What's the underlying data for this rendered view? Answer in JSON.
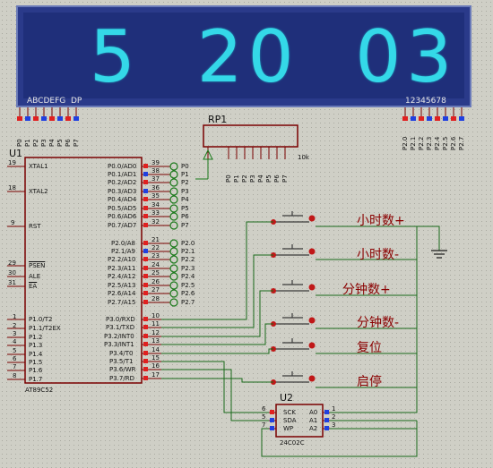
{
  "display": {
    "digits": "5  20  03",
    "left_label": "ABCDEFG  DP",
    "right_label": "12345678",
    "seg_color": "#34d8e8",
    "bg_color": "#1f2f7a"
  },
  "left_pins": [
    "P0",
    "P1",
    "P2",
    "P3",
    "P4",
    "P5",
    "P6",
    "P7"
  ],
  "right_pins": [
    "P2.0",
    "P2.1",
    "P2.2",
    "P2.3",
    "P2.4",
    "P2.5",
    "P2.6",
    "P2.7"
  ],
  "rp1": {
    "name": "RP1",
    "value": "10k",
    "pins": [
      "P0",
      "P1",
      "P2",
      "P3",
      "P4",
      "P5",
      "P6",
      "P7"
    ]
  },
  "u1": {
    "ref": "U1",
    "part": "AT89C52",
    "left_pins": [
      {
        "num": "19",
        "name": "XTAL1"
      },
      {
        "num": "18",
        "name": "XTAL2"
      },
      {
        "num": "9",
        "name": "RST"
      },
      {
        "num": "29",
        "name": "PSEN"
      },
      {
        "num": "30",
        "name": "ALE"
      },
      {
        "num": "31",
        "name": "EA"
      },
      {
        "num": "1",
        "name": "P1.0/T2"
      },
      {
        "num": "2",
        "name": "P1.1/T2EX"
      },
      {
        "num": "3",
        "name": "P1.2"
      },
      {
        "num": "4",
        "name": "P1.3"
      },
      {
        "num": "5",
        "name": "P1.4"
      },
      {
        "num": "6",
        "name": "P1.5"
      },
      {
        "num": "7",
        "name": "P1.6"
      },
      {
        "num": "8",
        "name": "P1.7"
      }
    ],
    "right_pins_p0": [
      {
        "num": "39",
        "name": "P0.0/AD0",
        "net": "P0"
      },
      {
        "num": "38",
        "name": "P0.1/AD1",
        "net": "P1"
      },
      {
        "num": "37",
        "name": "P0.2/AD2",
        "net": "P2"
      },
      {
        "num": "36",
        "name": "P0.3/AD3",
        "net": "P3"
      },
      {
        "num": "35",
        "name": "P0.4/AD4",
        "net": "P4"
      },
      {
        "num": "34",
        "name": "P0.5/AD5",
        "net": "P5"
      },
      {
        "num": "33",
        "name": "P0.6/AD6",
        "net": "P6"
      },
      {
        "num": "32",
        "name": "P0.7/AD7",
        "net": "P7"
      }
    ],
    "right_pins_p2": [
      {
        "num": "21",
        "name": "P2.0/A8",
        "net": "P2.0"
      },
      {
        "num": "22",
        "name": "P2.1/A9",
        "net": "P2.1"
      },
      {
        "num": "23",
        "name": "P2.2/A10",
        "net": "P2.2"
      },
      {
        "num": "24",
        "name": "P2.3/A11",
        "net": "P2.3"
      },
      {
        "num": "25",
        "name": "P2.4/A12",
        "net": "P2.4"
      },
      {
        "num": "26",
        "name": "P2.5/A13",
        "net": "P2.5"
      },
      {
        "num": "27",
        "name": "P2.6/A14",
        "net": "P2.6"
      },
      {
        "num": "28",
        "name": "P2.7/A15",
        "net": "P2.7"
      }
    ],
    "right_pins_p3": [
      {
        "num": "10",
        "name": "P3.0/RXD"
      },
      {
        "num": "11",
        "name": "P3.1/TXD"
      },
      {
        "num": "12",
        "name": "P3.2/INT0"
      },
      {
        "num": "13",
        "name": "P3.3/INT1"
      },
      {
        "num": "14",
        "name": "P3.4/T0"
      },
      {
        "num": "15",
        "name": "P3.5/T1"
      },
      {
        "num": "16",
        "name": "P3.6/WR"
      },
      {
        "num": "17",
        "name": "P3.7/RD"
      }
    ]
  },
  "buttons": [
    "小时数+",
    "小时数-",
    "分钟数+",
    "分钟数-",
    "复位",
    "启停"
  ],
  "u2": {
    "ref": "U2",
    "part": "24C02C",
    "left": [
      {
        "num": "6",
        "name": "SCK"
      },
      {
        "num": "5",
        "name": "SDA"
      },
      {
        "num": "7",
        "name": "WP"
      }
    ],
    "right": [
      {
        "num": "1",
        "name": "A0"
      },
      {
        "num": "2",
        "name": "A1"
      },
      {
        "num": "3",
        "name": "A2"
      }
    ]
  }
}
